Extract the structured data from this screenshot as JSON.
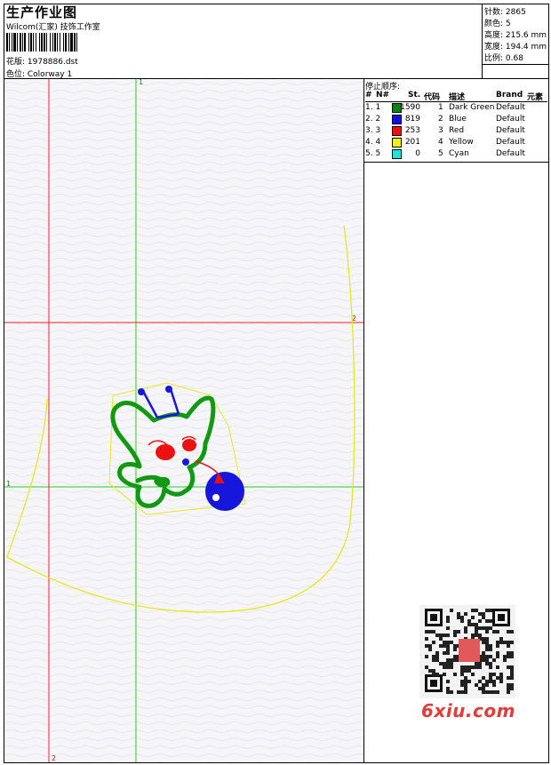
{
  "header": {
    "title": "生产作业图",
    "company": "Wilcom(汇家) 技饰工作室",
    "design_label": "花版: 1978886.dst",
    "colorway_label": "色位:  Colorway 1"
  },
  "info": {
    "stitches": "针数: 2865",
    "colors": "颜色: 5",
    "height": "高度: 215.6 mm",
    "width": "宽度: 194.4 mm",
    "scale": "比例: 0.68"
  },
  "sequence": {
    "label": "停止顺序:",
    "headers": {
      "hash": "#",
      "n": "N#",
      "st": "St.",
      "code": "代码",
      "desc": "描述",
      "brand": "Brand",
      "elem": "元素"
    },
    "rows": [
      {
        "idx": "1. 1",
        "color": "#108010",
        "st": "1590",
        "code": "1",
        "desc": "Dark Green",
        "brand": "Default"
      },
      {
        "idx": "2. 2",
        "color": "#1010e0",
        "st": "819",
        "code": "2",
        "desc": "Blue",
        "brand": "Default"
      },
      {
        "idx": "3. 3",
        "color": "#ee1010",
        "st": "253",
        "code": "3",
        "desc": "Red",
        "brand": "Default"
      },
      {
        "idx": "4. 4",
        "color": "#f0f020",
        "st": "201",
        "code": "4",
        "desc": "Yellow",
        "brand": "Default"
      },
      {
        "idx": "5. 5",
        "color": "#20e0e0",
        "st": "0",
        "code": "5",
        "desc": "Cyan",
        "brand": "Default"
      }
    ]
  },
  "canvas": {
    "guide_labels": {
      "green_top": "1",
      "green_left": "1",
      "red_right": "2",
      "red_bottom": "2"
    }
  },
  "watermark": {
    "text": "6xiu.com"
  }
}
